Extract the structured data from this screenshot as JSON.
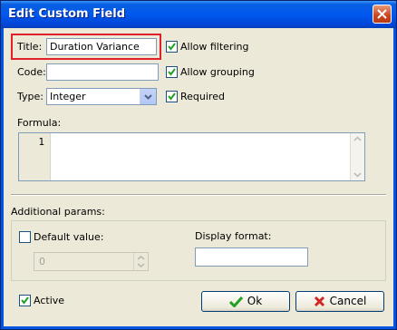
{
  "window": {
    "title": "Edit Custom Field"
  },
  "fields": {
    "title_label": "Title:",
    "title_value": "Duration Variance",
    "code_label": "Code:",
    "code_value": "",
    "type_label": "Type:",
    "type_value": "Integer",
    "formula_label": "Formula:",
    "formula_line_number": "1"
  },
  "options": {
    "allow_filtering": {
      "label": "Allow filtering",
      "checked": true
    },
    "allow_grouping": {
      "label": "Allow grouping",
      "checked": true
    },
    "required": {
      "label": "Required",
      "checked": true
    }
  },
  "additional": {
    "section_label": "Additional params:",
    "default_value_label": "Default value:",
    "default_value_checked": false,
    "default_value": "0",
    "display_format_label": "Display format:",
    "display_format_value": ""
  },
  "footer": {
    "active_label": "Active",
    "active_checked": true,
    "ok_label": "Ok",
    "cancel_label": "Cancel"
  },
  "colors": {
    "title_bar": "#0054e3",
    "highlight": "#e0202a",
    "check": "#21a121",
    "cancel_x": "#d42424"
  }
}
